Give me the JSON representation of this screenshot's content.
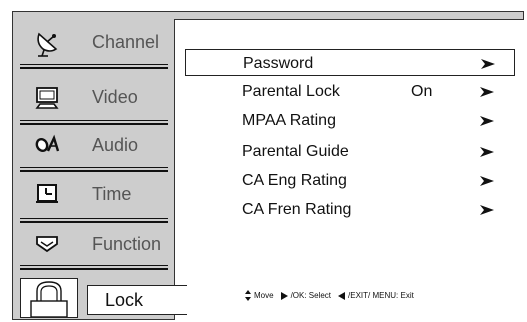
{
  "sidebar": {
    "items": [
      {
        "label": "Channel",
        "icon": "satellite-dish-icon"
      },
      {
        "label": "Video",
        "icon": "monitor-icon"
      },
      {
        "label": "Audio",
        "icon": "audio-icon"
      },
      {
        "label": "Time",
        "icon": "clock-icon"
      },
      {
        "label": "Function",
        "icon": "function-icon"
      }
    ],
    "lock": {
      "label": "Lock",
      "icon": "padlock-icon"
    }
  },
  "menu": {
    "items": [
      {
        "label": "Password",
        "value": "",
        "selected": true
      },
      {
        "label": "Parental Lock",
        "value": "On",
        "selected": false
      },
      {
        "label": "MPAA Rating",
        "value": "",
        "selected": false
      },
      {
        "label": "Parental Guide",
        "value": "",
        "selected": false
      },
      {
        "label": "CA Eng Rating",
        "value": "",
        "selected": false
      },
      {
        "label": "CA Fren Rating",
        "value": "",
        "selected": false
      }
    ]
  },
  "hint": {
    "move": "Move",
    "select": "/OK: Select",
    "exit": "/EXIT/ MENU: Exit"
  },
  "colors": {
    "panel_bg": "#cdcdcd",
    "content_bg": "#ffffff",
    "dim_label": "#555555"
  }
}
